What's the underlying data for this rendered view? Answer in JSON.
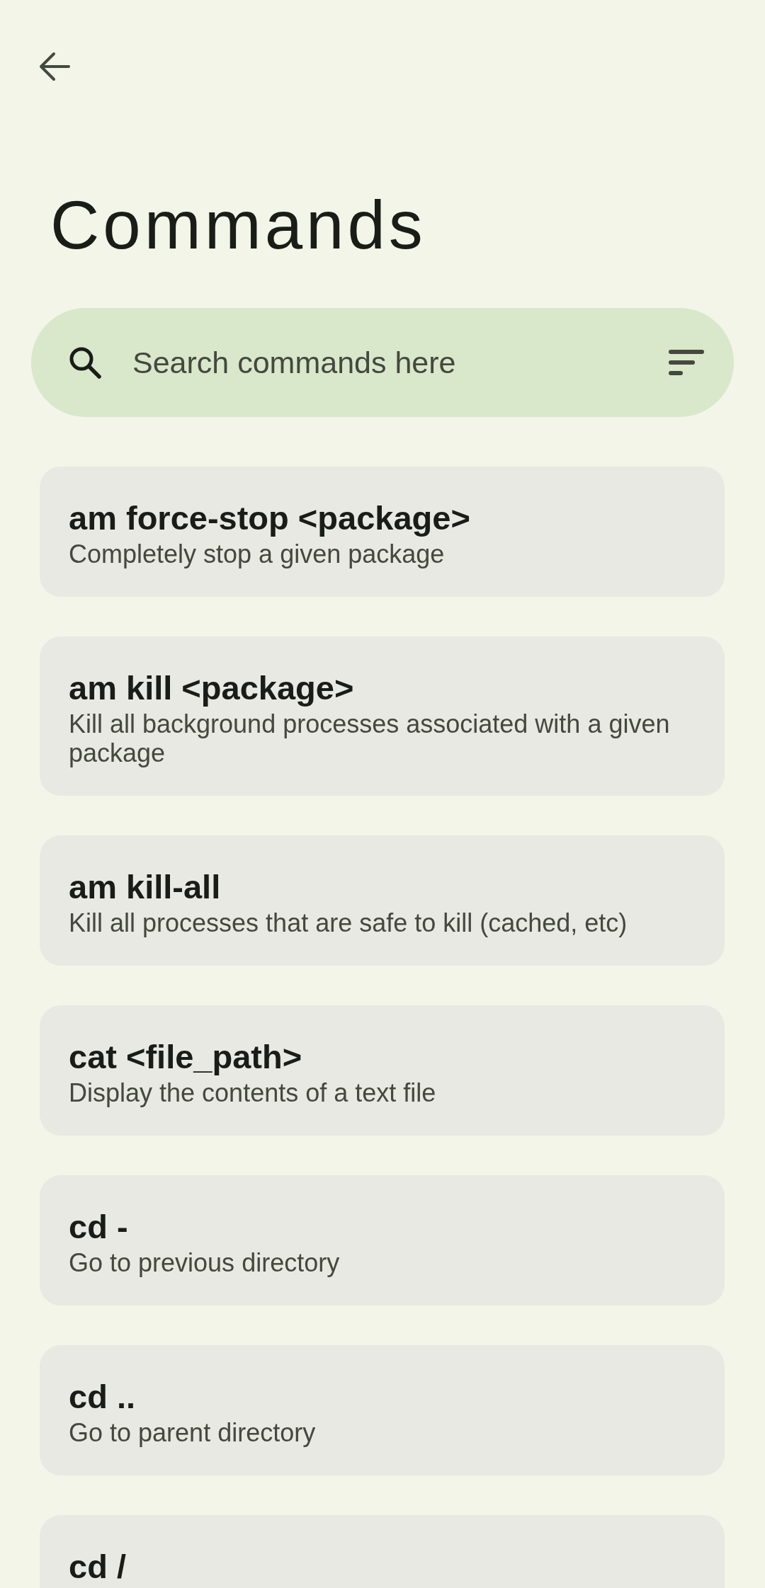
{
  "header": {
    "title": "Commands"
  },
  "search": {
    "placeholder": "Search commands here"
  },
  "commands": [
    {
      "name": "am force-stop <package>",
      "description": "Completely stop a given package"
    },
    {
      "name": "am kill <package>",
      "description": "Kill all background processes associated with a given package"
    },
    {
      "name": "am kill-all",
      "description": "Kill all processes that are safe to kill (cached, etc)"
    },
    {
      "name": "cat <file_path>",
      "description": "Display the contents of a text file"
    },
    {
      "name": "cd -",
      "description": "Go to previous directory"
    },
    {
      "name": "cd ..",
      "description": "Go to parent directory"
    },
    {
      "name": "cd /"
    }
  ]
}
